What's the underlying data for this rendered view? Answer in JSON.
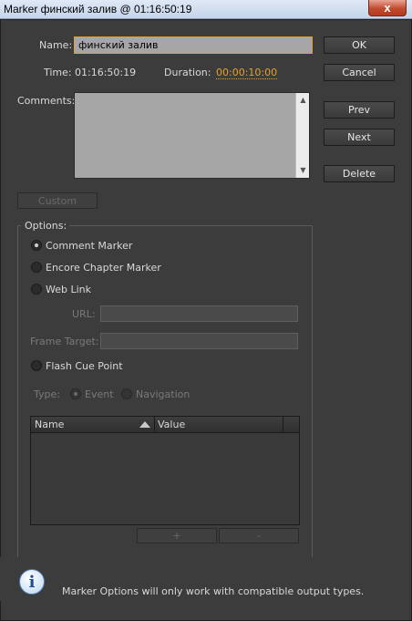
{
  "window": {
    "title": "Marker финский залив @ 01:16:50:19",
    "close_glyph": "x"
  },
  "form": {
    "name_label": "Name:",
    "name_value": "финский залив",
    "time_label": "Time:",
    "time_value": "01:16:50:19",
    "duration_label": "Duration:",
    "duration_value": "00:00:10:00",
    "comments_label": "Comments:",
    "custom_button": "Custom"
  },
  "buttons": {
    "ok": "OK",
    "cancel": "Cancel",
    "prev": "Prev",
    "next": "Next",
    "delete": "Delete"
  },
  "options": {
    "title": "Options:",
    "comment_marker": "Comment Marker",
    "encore_chapter_marker": "Encore Chapter Marker",
    "web_link": "Web Link",
    "url_label": "URL:",
    "frame_target_label": "Frame Target:",
    "flash_cue_point": "Flash Cue Point",
    "type_label": "Type:",
    "type_event": "Event",
    "type_navigation": "Navigation",
    "selected": "Comment Marker"
  },
  "table": {
    "columns": [
      "Name",
      "Value"
    ],
    "add_button": "+",
    "remove_button": "-"
  },
  "info": {
    "message": "Marker Options will only work with compatible output types.",
    "icon": "info-icon"
  },
  "colors": {
    "accent": "#e6a12b",
    "background": "#3c3c3c",
    "field": "#a6a6a6"
  }
}
